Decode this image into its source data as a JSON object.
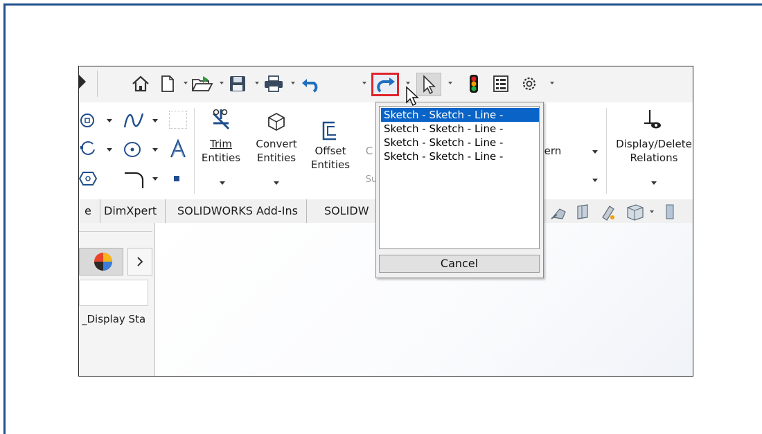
{
  "toolbar": {
    "icons": [
      "expand-arrow-icon",
      "home-icon",
      "new-document-icon",
      "open-folder-icon",
      "save-icon",
      "print-icon",
      "undo-icon",
      "redo-icon",
      "select-pointer-icon",
      "traffic-light-icon",
      "file-properties-icon",
      "options-gear-icon"
    ]
  },
  "ribbon": {
    "trim_line1": "Trim",
    "trim_line2": "Entities",
    "convert_line1": "Convert",
    "convert_line2": "Entities",
    "offset_line1": "Offset",
    "offset_line2": "Entities",
    "partial_c": "C",
    "partial_su": "Su",
    "pattern_partial": "ern",
    "display_line1": "Display/Delete",
    "display_line2": "Relations"
  },
  "tabs": [
    "e",
    "DimXpert",
    "SOLIDWORKS Add-Ins",
    "SOLIDW"
  ],
  "panel": {
    "display_states": "_Display Sta"
  },
  "redo_list": {
    "items": [
      "Sketch - Sketch - Line -",
      "Sketch - Sketch - Line -",
      "Sketch - Sketch - Line -",
      "Sketch - Sketch - Line -"
    ],
    "selected_index": 0,
    "cancel_label": "Cancel"
  },
  "colors": {
    "highlight_border": "#e0242b",
    "selection_blue": "#0a64c8",
    "frame_blue": "#1f4e8c"
  }
}
